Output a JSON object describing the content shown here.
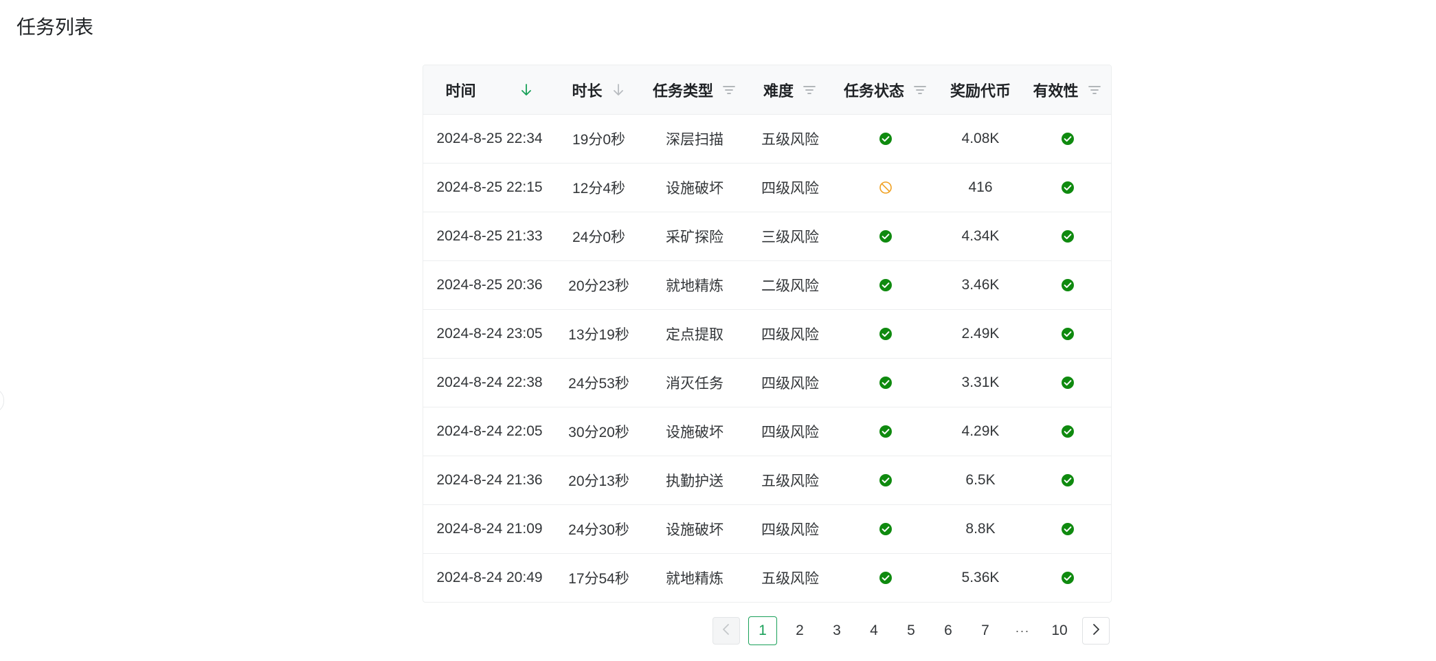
{
  "page": {
    "title": "任务列表"
  },
  "table": {
    "columns": [
      {
        "label": "时间",
        "icon": "sort-desc-active-icon"
      },
      {
        "label": "时长",
        "icon": "sort-desc-icon"
      },
      {
        "label": "任务类型",
        "icon": "filter-icon"
      },
      {
        "label": "难度",
        "icon": "filter-icon"
      },
      {
        "label": "任务状态",
        "icon": "filter-icon"
      },
      {
        "label": "奖励代币"
      },
      {
        "label": "有效性",
        "icon": "filter-icon"
      }
    ],
    "rows": [
      {
        "time": "2024-8-25 22:34",
        "duration": "19分0秒",
        "type": "深层扫描",
        "difficulty": "五级风险",
        "status": "success",
        "reward": "4.08K",
        "valid": "success"
      },
      {
        "time": "2024-8-25 22:15",
        "duration": "12分4秒",
        "type": "设施破坏",
        "difficulty": "四级风险",
        "status": "aborted",
        "reward": "416",
        "valid": "success"
      },
      {
        "time": "2024-8-25 21:33",
        "duration": "24分0秒",
        "type": "采矿探险",
        "difficulty": "三级风险",
        "status": "success",
        "reward": "4.34K",
        "valid": "success"
      },
      {
        "time": "2024-8-25 20:36",
        "duration": "20分23秒",
        "type": "就地精炼",
        "difficulty": "二级风险",
        "status": "success",
        "reward": "3.46K",
        "valid": "success"
      },
      {
        "time": "2024-8-24 23:05",
        "duration": "13分19秒",
        "type": "定点提取",
        "difficulty": "四级风险",
        "status": "success",
        "reward": "2.49K",
        "valid": "success"
      },
      {
        "time": "2024-8-24 22:38",
        "duration": "24分53秒",
        "type": "消灭任务",
        "difficulty": "四级风险",
        "status": "success",
        "reward": "3.31K",
        "valid": "success"
      },
      {
        "time": "2024-8-24 22:05",
        "duration": "30分20秒",
        "type": "设施破坏",
        "difficulty": "四级风险",
        "status": "success",
        "reward": "4.29K",
        "valid": "success"
      },
      {
        "time": "2024-8-24 21:36",
        "duration": "20分13秒",
        "type": "执勤护送",
        "difficulty": "五级风险",
        "status": "success",
        "reward": "6.5K",
        "valid": "success"
      },
      {
        "time": "2024-8-24 21:09",
        "duration": "24分30秒",
        "type": "设施破坏",
        "difficulty": "四级风险",
        "status": "success",
        "reward": "8.8K",
        "valid": "success"
      },
      {
        "time": "2024-8-24 20:49",
        "duration": "17分54秒",
        "type": "就地精炼",
        "difficulty": "五级风险",
        "status": "success",
        "reward": "5.36K",
        "valid": "success"
      }
    ]
  },
  "pagination": {
    "prev_icon": "chevron-left-icon",
    "next_icon": "chevron-right-icon",
    "pages": [
      "1",
      "2",
      "3",
      "4",
      "5",
      "6",
      "7"
    ],
    "ellipsis": "···",
    "last": "10",
    "current": "1"
  },
  "colors": {
    "success": "#0f8a0f",
    "warning": "#f0a020",
    "accent": "#18a058",
    "header_bg": "#f8f9fa",
    "border": "#eceeef"
  }
}
